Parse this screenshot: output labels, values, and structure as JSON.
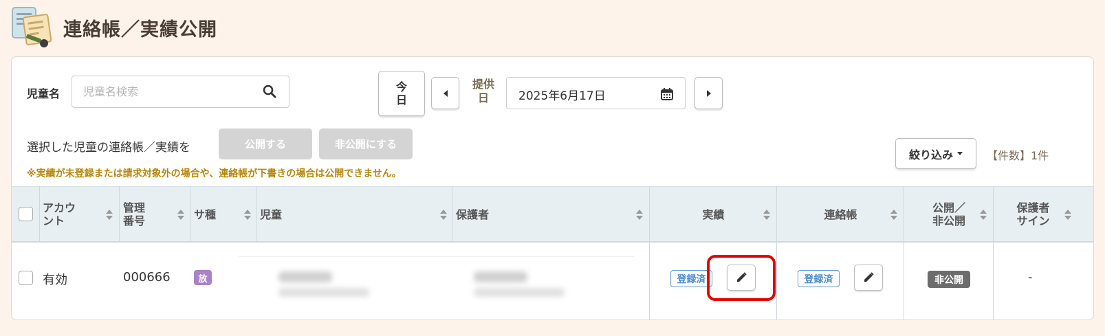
{
  "page": {
    "title": "連絡帳／実績公開"
  },
  "search": {
    "label": "児童名",
    "placeholder": "児童名検索"
  },
  "date_nav": {
    "today_line1": "今",
    "today_line2": "日",
    "label_line1": "提供",
    "label_line2": "日",
    "date_value": "2025年6月17日"
  },
  "bulk": {
    "prompt": "選択した児童の連絡帳／実績を",
    "publish_label": "公開する",
    "unpublish_label": "非公開にする",
    "notice": "※実績が未登録または請求対象外の場合や、連絡帳が下書きの場合は公開できません。"
  },
  "filter": {
    "label": "絞り込み",
    "count": "【件数】1件"
  },
  "table": {
    "headers": {
      "account_line1": "アカウ",
      "account_line2": "ント",
      "id_line1": "管理",
      "id_line2": "番号",
      "service": "サ種",
      "child": "児童",
      "guardian": "保護者",
      "record": "実績",
      "notebook": "連絡帳",
      "public_line1": "公開／",
      "public_line2": "非公開",
      "sign_line1": "保護者",
      "sign_line2": "サイン"
    },
    "rows": [
      {
        "account": "有効",
        "id": "000666",
        "service": "放",
        "record_status": "登録済",
        "notebook_status": "登録済",
        "public_status": "非公開",
        "sign": "-"
      }
    ]
  },
  "colors": {
    "background": "#fdf3ea",
    "header_bg": "#e8eff2",
    "service_badge": "#a982c8",
    "registered": "#4a8ad2",
    "private_badge": "#6c6c6c",
    "highlight": "#e80000",
    "notice": "#b8860b"
  },
  "icons": [
    "notebook-logo-icon",
    "search-icon",
    "calendar-icon",
    "chevron-left-icon",
    "chevron-right-icon",
    "pencil-icon",
    "sort-icon",
    "caret-down-icon"
  ]
}
